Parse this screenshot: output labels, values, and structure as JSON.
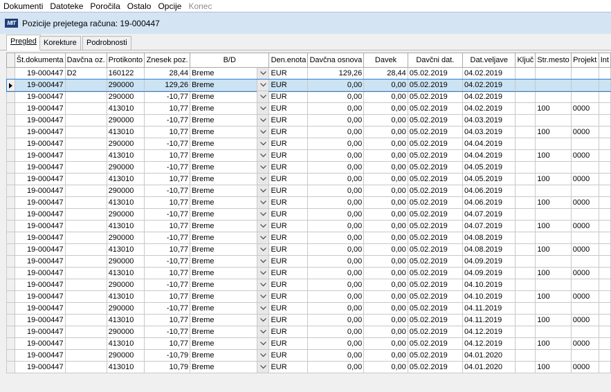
{
  "menu": [
    "Dokumenti",
    "Datoteke",
    "Poročila",
    "Ostalo",
    "Opcije",
    "Konec"
  ],
  "menu_disabled": [
    "Konec"
  ],
  "window": {
    "logo": "MIT",
    "title": "Pozicije prejetega računa: 19-000447"
  },
  "tabs": [
    "Pregled",
    "Korekture",
    "Podrobnosti"
  ],
  "active_tab": "Pregled",
  "columns": [
    "Št.dokumenta",
    "Davčna oz.",
    "Protikonto",
    "Znesek poz.",
    "B/D",
    "Den.enota",
    "Davčna osnova",
    "Davek",
    "Davčni dat.",
    "Dat.veljave",
    "Ključ",
    "Str.mesto",
    "Projekt",
    "Int"
  ],
  "selected_row": 1,
  "rows": [
    [
      "19-000447",
      "D2",
      "160122",
      "28,44",
      "Breme",
      "EUR",
      "129,26",
      "28,44",
      "05.02.2019",
      "04.02.2019",
      "",
      "",
      ""
    ],
    [
      "19-000447",
      "",
      "290000",
      "129,26",
      "Breme",
      "EUR",
      "0,00",
      "0,00",
      "05.02.2019",
      "04.02.2019",
      "",
      "",
      ""
    ],
    [
      "19-000447",
      "",
      "290000",
      "-10,77",
      "Breme",
      "EUR",
      "0,00",
      "0,00",
      "05.02.2019",
      "04.02.2019",
      "",
      "",
      ""
    ],
    [
      "19-000447",
      "",
      "413010",
      "10,77",
      "Breme",
      "EUR",
      "0,00",
      "0,00",
      "05.02.2019",
      "04.02.2019",
      "",
      "100",
      "0000"
    ],
    [
      "19-000447",
      "",
      "290000",
      "-10,77",
      "Breme",
      "EUR",
      "0,00",
      "0,00",
      "05.02.2019",
      "04.03.2019",
      "",
      "",
      ""
    ],
    [
      "19-000447",
      "",
      "413010",
      "10,77",
      "Breme",
      "EUR",
      "0,00",
      "0,00",
      "05.02.2019",
      "04.03.2019",
      "",
      "100",
      "0000"
    ],
    [
      "19-000447",
      "",
      "290000",
      "-10,77",
      "Breme",
      "EUR",
      "0,00",
      "0,00",
      "05.02.2019",
      "04.04.2019",
      "",
      "",
      ""
    ],
    [
      "19-000447",
      "",
      "413010",
      "10,77",
      "Breme",
      "EUR",
      "0,00",
      "0,00",
      "05.02.2019",
      "04.04.2019",
      "",
      "100",
      "0000"
    ],
    [
      "19-000447",
      "",
      "290000",
      "-10,77",
      "Breme",
      "EUR",
      "0,00",
      "0,00",
      "05.02.2019",
      "04.05.2019",
      "",
      "",
      ""
    ],
    [
      "19-000447",
      "",
      "413010",
      "10,77",
      "Breme",
      "EUR",
      "0,00",
      "0,00",
      "05.02.2019",
      "04.05.2019",
      "",
      "100",
      "0000"
    ],
    [
      "19-000447",
      "",
      "290000",
      "-10,77",
      "Breme",
      "EUR",
      "0,00",
      "0,00",
      "05.02.2019",
      "04.06.2019",
      "",
      "",
      ""
    ],
    [
      "19-000447",
      "",
      "413010",
      "10,77",
      "Breme",
      "EUR",
      "0,00",
      "0,00",
      "05.02.2019",
      "04.06.2019",
      "",
      "100",
      "0000"
    ],
    [
      "19-000447",
      "",
      "290000",
      "-10,77",
      "Breme",
      "EUR",
      "0,00",
      "0,00",
      "05.02.2019",
      "04.07.2019",
      "",
      "",
      ""
    ],
    [
      "19-000447",
      "",
      "413010",
      "10,77",
      "Breme",
      "EUR",
      "0,00",
      "0,00",
      "05.02.2019",
      "04.07.2019",
      "",
      "100",
      "0000"
    ],
    [
      "19-000447",
      "",
      "290000",
      "-10,77",
      "Breme",
      "EUR",
      "0,00",
      "0,00",
      "05.02.2019",
      "04.08.2019",
      "",
      "",
      ""
    ],
    [
      "19-000447",
      "",
      "413010",
      "10,77",
      "Breme",
      "EUR",
      "0,00",
      "0,00",
      "05.02.2019",
      "04.08.2019",
      "",
      "100",
      "0000"
    ],
    [
      "19-000447",
      "",
      "290000",
      "-10,77",
      "Breme",
      "EUR",
      "0,00",
      "0,00",
      "05.02.2019",
      "04.09.2019",
      "",
      "",
      ""
    ],
    [
      "19-000447",
      "",
      "413010",
      "10,77",
      "Breme",
      "EUR",
      "0,00",
      "0,00",
      "05.02.2019",
      "04.09.2019",
      "",
      "100",
      "0000"
    ],
    [
      "19-000447",
      "",
      "290000",
      "-10,77",
      "Breme",
      "EUR",
      "0,00",
      "0,00",
      "05.02.2019",
      "04.10.2019",
      "",
      "",
      ""
    ],
    [
      "19-000447",
      "",
      "413010",
      "10,77",
      "Breme",
      "EUR",
      "0,00",
      "0,00",
      "05.02.2019",
      "04.10.2019",
      "",
      "100",
      "0000"
    ],
    [
      "19-000447",
      "",
      "290000",
      "-10,77",
      "Breme",
      "EUR",
      "0,00",
      "0,00",
      "05.02.2019",
      "04.11.2019",
      "",
      "",
      ""
    ],
    [
      "19-000447",
      "",
      "413010",
      "10,77",
      "Breme",
      "EUR",
      "0,00",
      "0,00",
      "05.02.2019",
      "04.11.2019",
      "",
      "100",
      "0000"
    ],
    [
      "19-000447",
      "",
      "290000",
      "-10,77",
      "Breme",
      "EUR",
      "0,00",
      "0,00",
      "05.02.2019",
      "04.12.2019",
      "",
      "",
      ""
    ],
    [
      "19-000447",
      "",
      "413010",
      "10,77",
      "Breme",
      "EUR",
      "0,00",
      "0,00",
      "05.02.2019",
      "04.12.2019",
      "",
      "100",
      "0000"
    ],
    [
      "19-000447",
      "",
      "290000",
      "-10,79",
      "Breme",
      "EUR",
      "0,00",
      "0,00",
      "05.02.2019",
      "04.01.2020",
      "",
      "",
      ""
    ],
    [
      "19-000447",
      "",
      "413010",
      "10,79",
      "Breme",
      "EUR",
      "0,00",
      "0,00",
      "05.02.2019",
      "04.01.2020",
      "",
      "100",
      "0000"
    ]
  ]
}
